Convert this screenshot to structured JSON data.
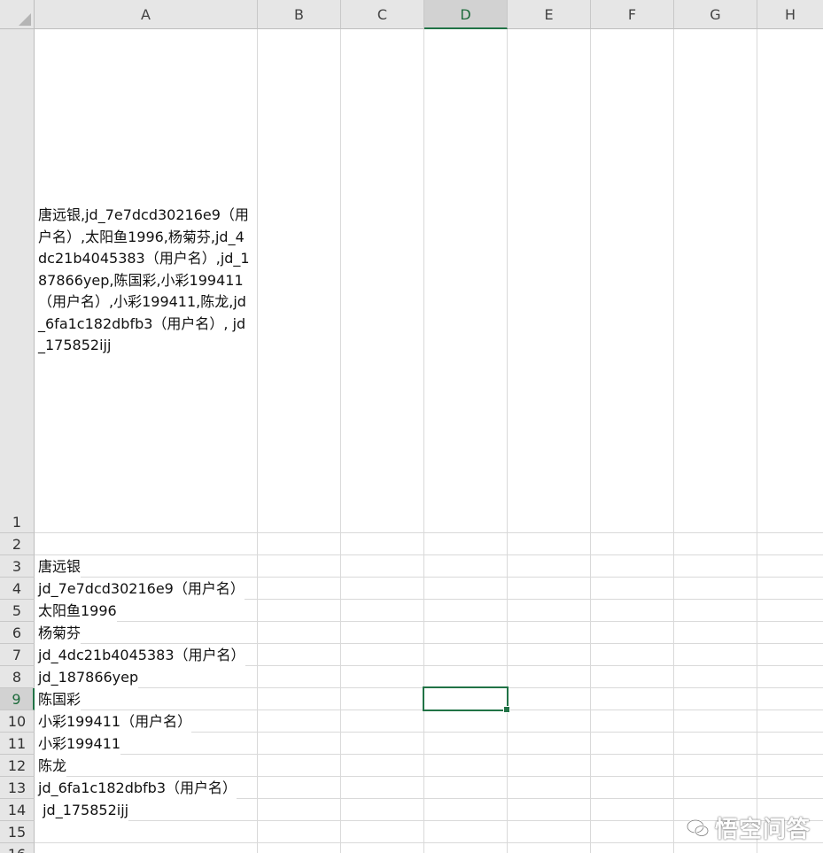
{
  "columns": [
    "A",
    "B",
    "C",
    "D",
    "E",
    "F",
    "G",
    "H"
  ],
  "active_column": "D",
  "rows": [
    "1",
    "2",
    "3",
    "4",
    "5",
    "6",
    "7",
    "8",
    "9",
    "10",
    "11",
    "12",
    "13",
    "14",
    "15",
    "16"
  ],
  "active_row": "9",
  "cells": {
    "A1": "唐远银,jd_7e7dcd30216e9（用户名）,太阳鱼1996,杨菊芬,jd_4dc21b4045383（用户名）,jd_187866yep,陈国彩,小彩199411（用户名）,小彩199411,陈龙,jd_6fa1c182dbfb3（用户名）, jd_175852ijj",
    "A3": "唐远银",
    "A4": "jd_7e7dcd30216e9（用户名）",
    "A5": "太阳鱼1996",
    "A6": "杨菊芬",
    "A7": "jd_4dc21b4045383（用户名）",
    "A8": "jd_187866yep",
    "A9": "陈国彩",
    "A10": "小彩199411（用户名）",
    "A11": "小彩199411",
    "A12": "陈龙",
    "A13": "jd_6fa1c182dbfb3（用户名）",
    "A14": " jd_175852ijj"
  },
  "selected_cell": "D9",
  "watermark": {
    "text": "悟空问答",
    "icon": "chat-bubbles-logo-icon"
  },
  "colors": {
    "accent": "#217346",
    "header_bg": "#e6e6e6",
    "active_header_bg": "#d2d2d2",
    "gridline": "#d9d9d9"
  }
}
